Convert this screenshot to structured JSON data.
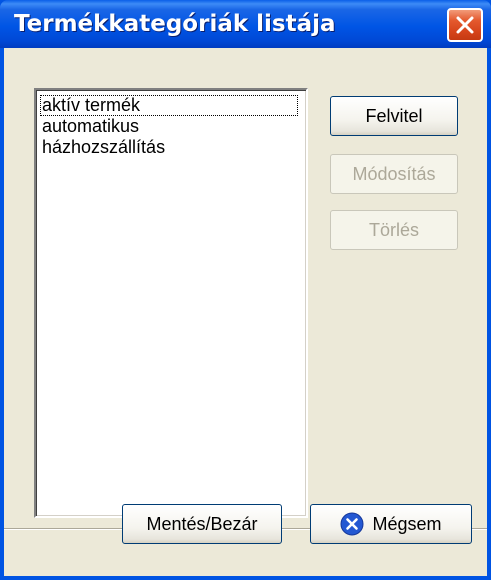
{
  "window": {
    "title": "Termékkategóriák listája"
  },
  "list": {
    "items": [
      "aktív termék",
      "automatikus",
      "házhozszállítás"
    ],
    "focused_index": 0
  },
  "buttons": {
    "add": "Felvitel",
    "modify": "Módosítás",
    "delete": "Törlés",
    "save_close": "Mentés/Bezár",
    "cancel": "Mégsem"
  },
  "states": {
    "modify_enabled": false,
    "delete_enabled": false
  },
  "colors": {
    "titlebar": "#0054e3",
    "close_button": "#d7451c",
    "dialog_background": "#ece9d8",
    "disabled_text": "#aca899",
    "cancel_icon": "#2458d2"
  },
  "icons": {
    "close": "close-icon",
    "cancel": "cancel-x-circle-icon"
  }
}
